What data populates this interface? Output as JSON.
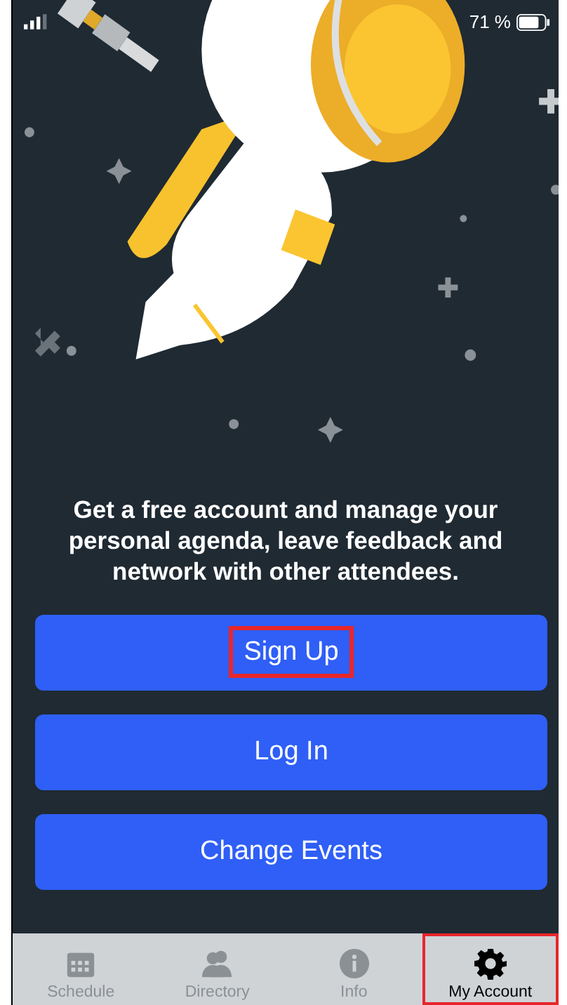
{
  "status_bar": {
    "battery": "71 %"
  },
  "message": "Get a free account and manage your personal agenda, leave feedback and network with other attendees.",
  "buttons": [
    {
      "label": "Sign Up",
      "highlighted": true
    },
    {
      "label": "Log In",
      "highlighted": false
    },
    {
      "label": "Change Events",
      "highlighted": false
    }
  ],
  "tabs": [
    {
      "label": "Schedule",
      "kind": "calendar",
      "selected": false,
      "highlighted": false
    },
    {
      "label": "Directory",
      "kind": "people",
      "selected": false,
      "highlighted": false
    },
    {
      "label": "Info",
      "kind": "info",
      "selected": false,
      "highlighted": false
    },
    {
      "label": "My Account",
      "kind": "gear",
      "selected": true,
      "highlighted": true
    }
  ]
}
